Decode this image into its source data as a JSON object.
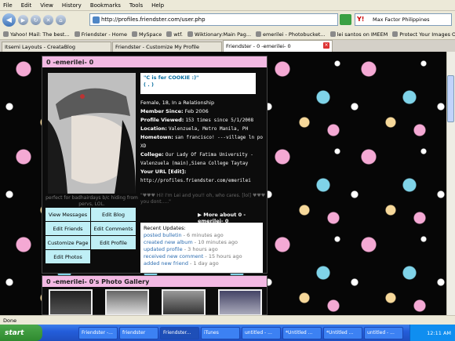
{
  "menu": [
    "File",
    "Edit",
    "View",
    "History",
    "Bookmarks",
    "Tools",
    "Help"
  ],
  "nav": {
    "url": "http://profiles.friendster.com/user.php",
    "search_value": "Max Factor Philippines"
  },
  "bookmarks": [
    "Yahoo! Mail: The best...",
    "Friendster - Home",
    "MySpace",
    "wtf.",
    "Wiktionary:Main Pag...",
    "emerilei - Photobucket...",
    "lei santos on IMEEM",
    "Protect Your Images O..."
  ],
  "tabs": [
    {
      "label": "Itsemi Layouts - CreataBlog"
    },
    {
      "label": "Friendster - Customize My Profile"
    },
    {
      "label": "Friendster - 0 -emerilei- 0"
    }
  ],
  "profile": {
    "header": "0 -emerilei- 0",
    "caption": "perfect for badhairdays b/c hiding from pervs, LOL.",
    "cookie_line1": "\"C is fer COOKIE :)\"",
    "cookie_line2": "( . )",
    "info": {
      "status": "Female, 18, In a Relationship",
      "member_label": "Member Since:",
      "member_value": "Feb 2006",
      "viewed_label": "Profile Viewed:",
      "viewed_value": "153 times since 5/1/2008",
      "location_label": "Location:",
      "location_value": "Valenzuela, Metro Manila, PH",
      "hometown_label": "Hometown:",
      "hometown_value": "san francisco! ---village ln po XD",
      "college_label": "College:",
      "college_value": "Our Lady Of Fatima University - Valenzuela (main),Siena College Taytay",
      "url_label": "Your URL [Edit]:",
      "url_value": "http://profiles.friendster.com/emerilei"
    },
    "quote": "\"♥♥♥ Hi! I'm Lei and you!! oh, who cares. [lol] ♥♥♥ you dont.....\"",
    "more": "▶ More about 0 -emerilei- 0",
    "buttons": [
      "View Messages",
      "Edit Blog",
      "Edit Friends",
      "Edit Comments",
      "Customize Page",
      "Edit Profile",
      "Edit Photos"
    ],
    "updates_title": "Recent Updates:",
    "updates": [
      {
        "text": "posted bulletin",
        "time": "- 6 minutes ago"
      },
      {
        "text": "created new album",
        "time": "- 10 minutes ago"
      },
      {
        "text": "updated profile",
        "time": "- 3 hours ago"
      },
      {
        "text": "received new comment",
        "time": "- 15 hours ago"
      },
      {
        "text": "added new friend",
        "time": "- 1 day ago"
      }
    ]
  },
  "gallery": {
    "header": "0 -emerilei- 0's Photo Gallery"
  },
  "status_bar": "Done",
  "taskbar": {
    "start": "start",
    "tasks": [
      "Friendster -...",
      "friendster",
      "Friendster...",
      "iTunes",
      "untitled - ...",
      "*Untitled ...",
      "*Untitled ...",
      "untitled - ..."
    ],
    "clock": "12:11 AM"
  }
}
